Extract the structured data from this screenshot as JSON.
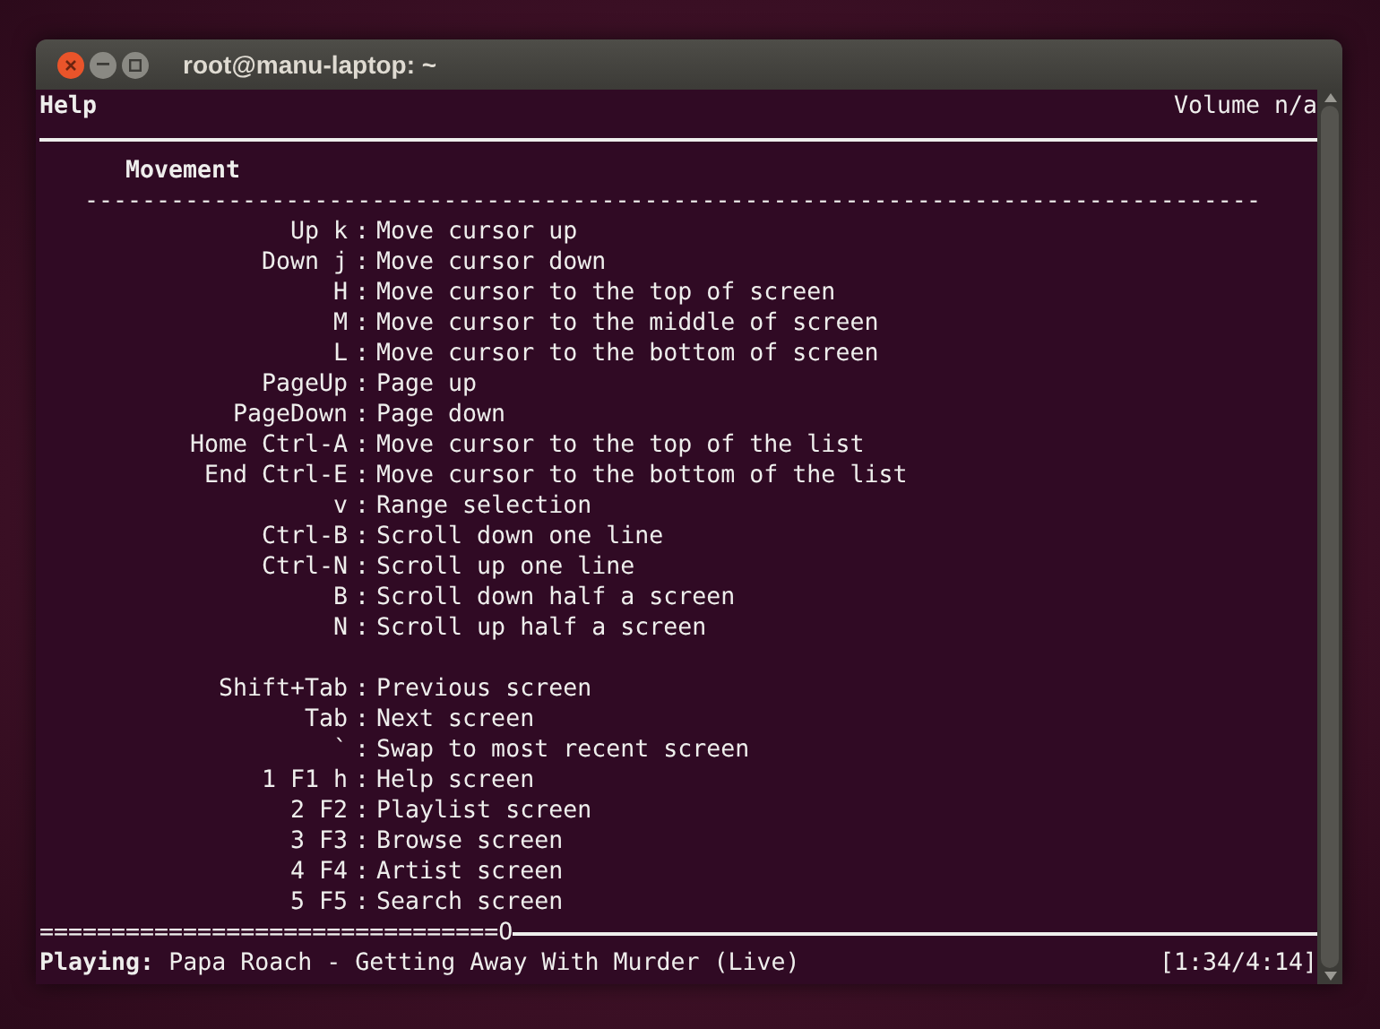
{
  "window": {
    "title": "root@manu-laptop: ~"
  },
  "header": {
    "title": "Help",
    "volume": "Volume n/a"
  },
  "section": {
    "heading": "Movement",
    "separator": "----------------------------------------------------------------------------------"
  },
  "groups": [
    {
      "rows": [
        {
          "keys": "Up k",
          "sep": ":",
          "action": "Move cursor up"
        },
        {
          "keys": "Down j",
          "sep": ":",
          "action": "Move cursor down"
        },
        {
          "keys": "H",
          "sep": ":",
          "action": "Move cursor to the top of screen"
        },
        {
          "keys": "M",
          "sep": ":",
          "action": "Move cursor to the middle of screen"
        },
        {
          "keys": "L",
          "sep": ":",
          "action": "Move cursor to the bottom of screen"
        },
        {
          "keys": "PageUp",
          "sep": ":",
          "action": "Page up"
        },
        {
          "keys": "PageDown",
          "sep": ":",
          "action": "Page down"
        },
        {
          "keys": "Home Ctrl-A",
          "sep": ":",
          "action": "Move cursor to the top of the list"
        },
        {
          "keys": "End Ctrl-E",
          "sep": ":",
          "action": "Move cursor to the bottom of the list"
        },
        {
          "keys": "v",
          "sep": ":",
          "action": "Range selection"
        },
        {
          "keys": "Ctrl-B",
          "sep": ":",
          "action": "Scroll down one line"
        },
        {
          "keys": "Ctrl-N",
          "sep": ":",
          "action": "Scroll up one line"
        },
        {
          "keys": "B",
          "sep": ":",
          "action": "Scroll down half a screen"
        },
        {
          "keys": "N",
          "sep": ":",
          "action": "Scroll up half a screen"
        }
      ]
    },
    {
      "rows": [
        {
          "keys": "Shift+Tab",
          "sep": ":",
          "action": "Previous screen"
        },
        {
          "keys": "Tab",
          "sep": ":",
          "action": "Next screen"
        },
        {
          "keys": "`",
          "sep": ":",
          "action": "Swap to most recent screen"
        },
        {
          "keys": "1 F1 h",
          "sep": ":",
          "action": "Help screen"
        },
        {
          "keys": "2 F2",
          "sep": ":",
          "action": "Playlist screen"
        },
        {
          "keys": "3 F3",
          "sep": ":",
          "action": "Browse screen"
        },
        {
          "keys": "4 F4",
          "sep": ":",
          "action": "Artist screen"
        },
        {
          "keys": "5 F5",
          "sep": ":",
          "action": "Search screen"
        }
      ]
    }
  ],
  "progress": {
    "text": "================================O"
  },
  "status": {
    "label": "Playing:",
    "track": "Papa Roach - Getting Away With Murder (Live)",
    "time": "[1:34/4:14]"
  }
}
